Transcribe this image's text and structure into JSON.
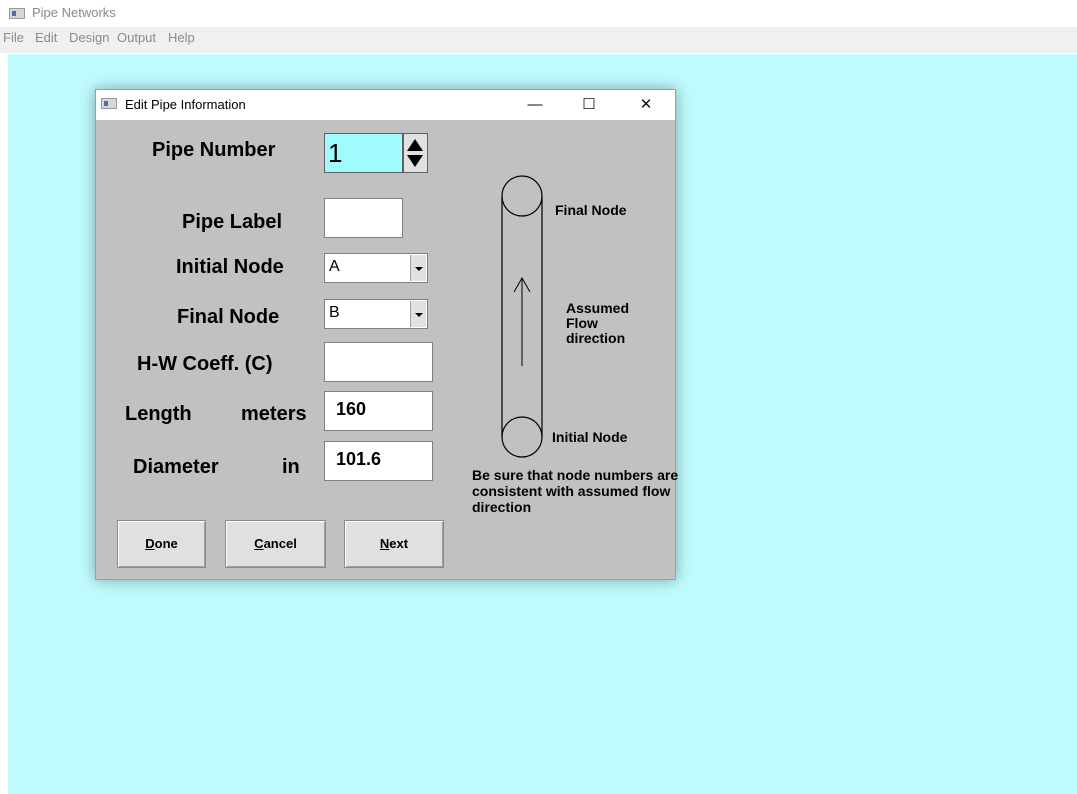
{
  "app": {
    "title": "Pipe Networks"
  },
  "menu": [
    "File",
    "Edit",
    "Design",
    "Output",
    "Help"
  ],
  "dialog": {
    "title": "Edit Pipe Information",
    "controls": {
      "minimize": "—",
      "maximize": "☐",
      "close": "✕"
    },
    "fields": {
      "pipe_number": {
        "label": "Pipe Number",
        "value": "1"
      },
      "pipe_label": {
        "label": "Pipe Label",
        "value": ""
      },
      "initial_node": {
        "label": "Initial Node",
        "value": "A"
      },
      "final_node": {
        "label": "Final Node",
        "value": "B"
      },
      "hw_coeff": {
        "label": "H-W Coeff. (C)",
        "value": ""
      },
      "length": {
        "label": "Length",
        "unit": "meters",
        "value": "160"
      },
      "diameter": {
        "label": "Diameter",
        "unit": "in",
        "value": "101.6"
      }
    },
    "diagram": {
      "final_node": "Final Node",
      "initial_node": "Initial Node",
      "flow_label": [
        "Assumed",
        "Flow",
        "direction"
      ]
    },
    "note": "Be sure that node numbers are consistent with assumed flow direction",
    "buttons": {
      "done": {
        "mnemonic": "D",
        "rest": "one"
      },
      "cancel": {
        "mnemonic": "C",
        "rest": "ancel"
      },
      "next": {
        "mnemonic": "N",
        "rest": "ext"
      }
    }
  },
  "colors": {
    "workspace": "#bffbfd",
    "dialog_bg": "#c1c1c1",
    "pipe_number_bg": "#9ffbfd"
  }
}
